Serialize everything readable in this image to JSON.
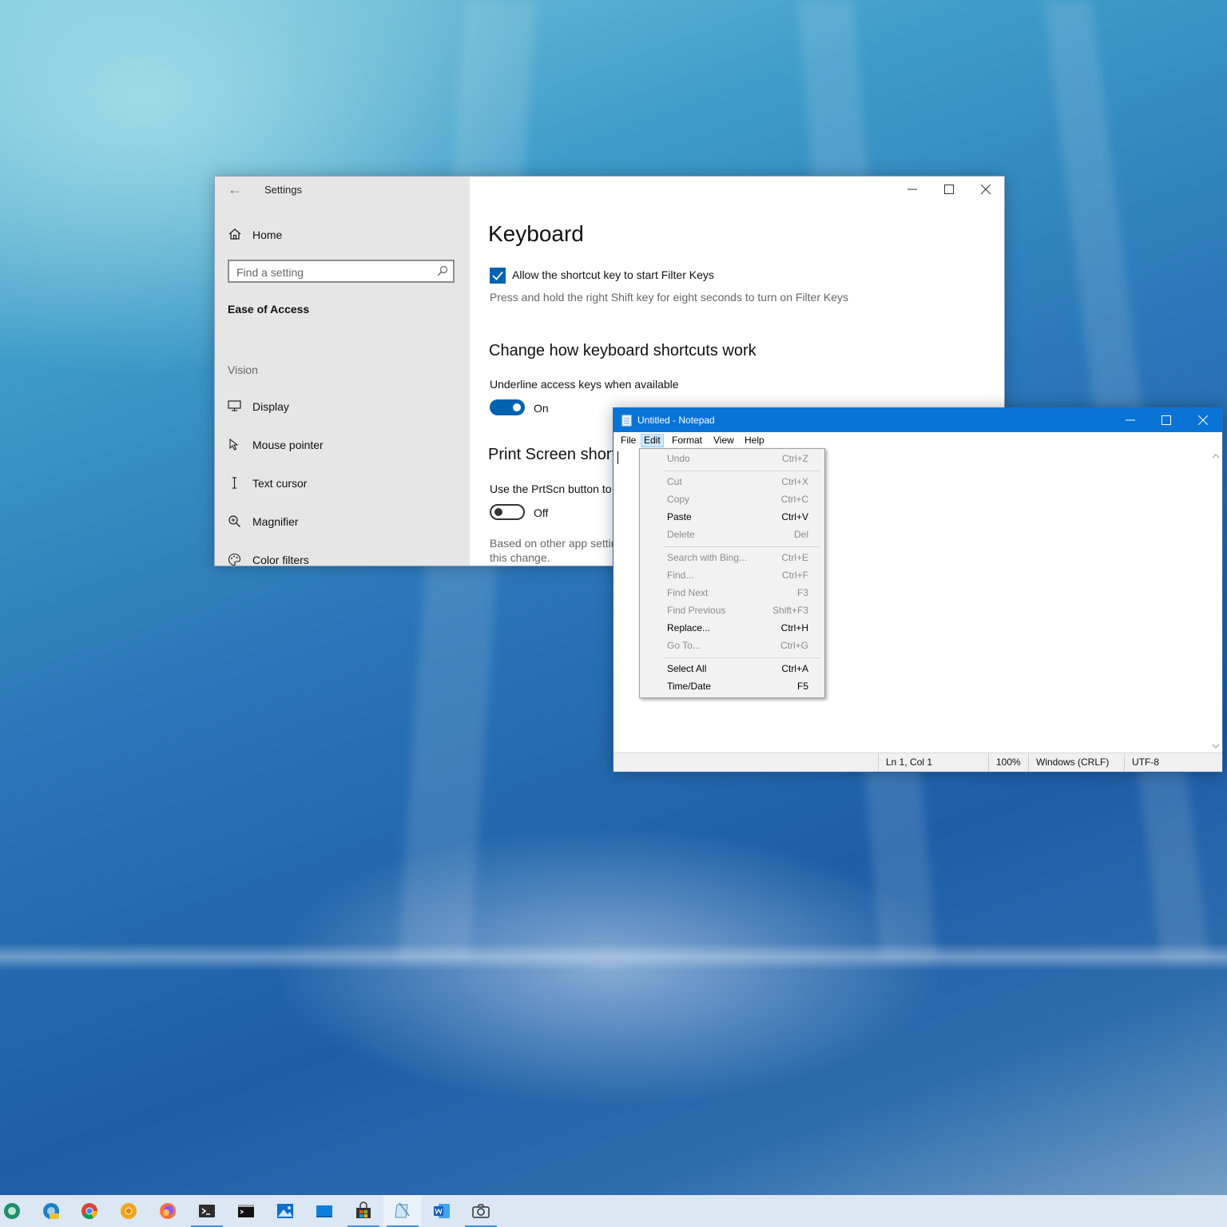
{
  "settings": {
    "title": "Settings",
    "nav": {
      "home": "Home",
      "search_placeholder": "Find a setting",
      "category": "Ease of Access",
      "section": "Vision",
      "items": [
        "Display",
        "Mouse pointer",
        "Text cursor",
        "Magnifier",
        "Color filters"
      ]
    },
    "main": {
      "page_title": "Keyboard",
      "filter_keys_checkbox": {
        "label": "Allow the shortcut key to start Filter Keys",
        "checked": true
      },
      "filter_keys_hint": "Press and hold the right Shift key for eight seconds to turn on Filter Keys",
      "shortcuts_heading": "Change how keyboard shortcuts work",
      "underline_label": "Underline access keys when available",
      "underline_toggle": {
        "state": "On",
        "on": true
      },
      "print_heading": "Print Screen short",
      "prtscn_label": "Use the PrtScn button to",
      "prtscn_toggle": {
        "state": "Off",
        "on": false
      },
      "based_text": "Based on other app settin this change."
    },
    "accent_color": "#0063b1"
  },
  "notepad": {
    "title": "Untitled - Notepad",
    "menu": [
      "File",
      "Edit",
      "Format",
      "View",
      "Help"
    ],
    "active_menu": "Edit",
    "status": {
      "position": "Ln 1, Col 1",
      "zoom": "100%",
      "line_ending": "Windows (CRLF)",
      "encoding": "UTF-8"
    },
    "titlebar_color": "#0a74d6"
  },
  "edit_menu": {
    "items": [
      {
        "label": "Undo",
        "shortcut": "Ctrl+Z",
        "enabled": false
      },
      {
        "label": "Cut",
        "shortcut": "Ctrl+X",
        "enabled": false
      },
      {
        "label": "Copy",
        "shortcut": "Ctrl+C",
        "enabled": false
      },
      {
        "label": "Paste",
        "shortcut": "Ctrl+V",
        "enabled": true
      },
      {
        "label": "Delete",
        "shortcut": "Del",
        "enabled": false
      },
      {
        "label": "Search with Bing...",
        "shortcut": "Ctrl+E",
        "enabled": false
      },
      {
        "label": "Find...",
        "shortcut": "Ctrl+F",
        "enabled": false
      },
      {
        "label": "Find Next",
        "shortcut": "F3",
        "enabled": false
      },
      {
        "label": "Find Previous",
        "shortcut": "Shift+F3",
        "enabled": false
      },
      {
        "label": "Replace...",
        "shortcut": "Ctrl+H",
        "enabled": true
      },
      {
        "label": "Go To...",
        "shortcut": "Ctrl+G",
        "enabled": false
      },
      {
        "label": "Select All",
        "shortcut": "Ctrl+A",
        "enabled": true
      },
      {
        "label": "Time/Date",
        "shortcut": "F5",
        "enabled": true
      }
    ]
  },
  "taskbar": {
    "icons": [
      "edge-dev-icon",
      "edge-canary-icon",
      "chrome-icon",
      "chrome-canary-icon",
      "firefox-icon",
      "terminal-icon",
      "command-prompt-icon",
      "photos-icon",
      "mail-icon",
      "store-icon",
      "notepad-icon",
      "word-icon",
      "camera-icon"
    ]
  }
}
